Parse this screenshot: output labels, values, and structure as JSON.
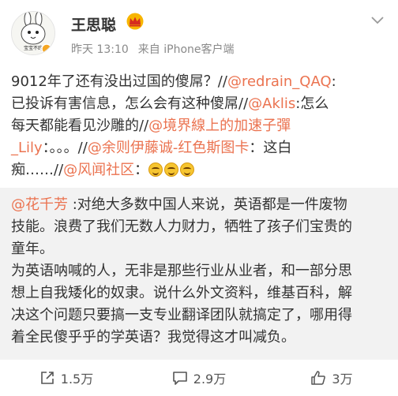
{
  "post": {
    "username": "王思聪",
    "time": "昨天 13:10",
    "source": "来自 iPhone客户端",
    "avatar_badge": "宝宝不约",
    "text_lines": [
      [
        {
          "t": "9012年了还有没出过国的傻屌？//"
        },
        {
          "t": "@redrain_QAQ",
          "m": true
        },
        {
          "t": ":"
        }
      ],
      [
        {
          "t": "已投诉有害信息，怎么会有这种傻屌//"
        },
        {
          "t": "@Aklis",
          "m": true
        },
        {
          "t": ":怎么"
        }
      ],
      [
        {
          "t": "每天都能看见沙雕的//"
        },
        {
          "t": "@境界線上的加速子彈",
          "m": true
        }
      ],
      [
        {
          "t": "_Lily",
          "m": true
        },
        {
          "t": "：。。。//"
        },
        {
          "t": "@余则伊藤诚-红色斯图卡",
          "m": true
        },
        {
          "t": "：这白"
        }
      ],
      [
        {
          "t": "痴……//"
        },
        {
          "t": "@风闻社区",
          "m": true
        },
        {
          "t": "："
        },
        {
          "e": 3
        }
      ]
    ]
  },
  "quote": {
    "text_lines": [
      [
        {
          "t": "@花千芳",
          "m": true
        },
        {
          "t": " :对绝大多数中国人来说，英语都是一件废物"
        }
      ],
      [
        {
          "t": "技能。浪费了我们无数人力财力，牺牲了孩子们宝贵的"
        }
      ],
      [
        {
          "t": "童年。"
        }
      ],
      [
        {
          "t": "为英语呐喊的人，无非是那些行业从业者，和一部分思"
        }
      ],
      [
        {
          "t": "想上自我矮化的奴隶。说什么外文资料，维基百科，解"
        }
      ],
      [
        {
          "t": "决这个问题只要搞一支专业翻译团队就搞定了，哪用得"
        }
      ],
      [
        {
          "t": "着全民傻乎乎的学英语？我觉得这才叫减负。"
        }
      ]
    ]
  },
  "actions": {
    "repost_count": "1.5万",
    "comment_count": "2.9万",
    "like_count": "3万"
  },
  "colors": {
    "mention": "#eb7350",
    "quote_bg": "#f2f2f2",
    "meta": "#8a8a8a"
  },
  "icons": [
    "crown-icon",
    "chevron-down-icon",
    "repost-icon",
    "comment-icon",
    "like-icon",
    "laughing-emoji-icon"
  ]
}
